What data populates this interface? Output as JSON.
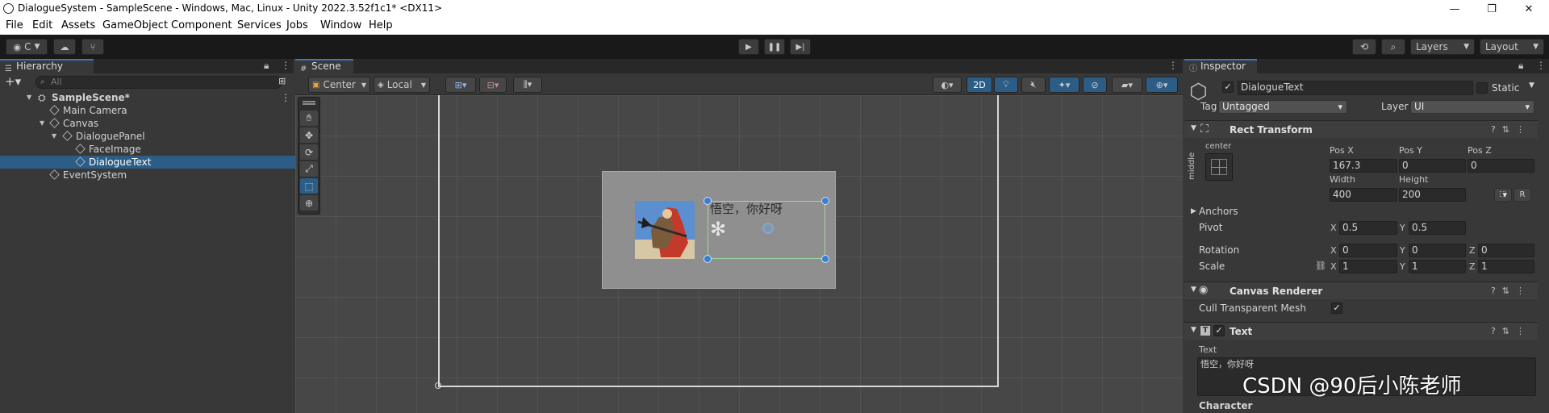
{
  "titlebar": {
    "title": "DialogueSystem - SampleScene - Windows, Mac, Linux - Unity 2022.3.52f1c1* <DX11>",
    "minimize": "—",
    "maximize": "❐",
    "close": "✕"
  },
  "menu": [
    "File",
    "Edit",
    "Assets",
    "GameObject",
    "Component",
    "Services",
    "Jobs",
    "Window",
    "Help"
  ],
  "toolbar": {
    "account_label": "C",
    "layers_label": "Layers",
    "layout_label": "Layout"
  },
  "hierarchy": {
    "tab": "Hierarchy",
    "search_placeholder": "All",
    "items": [
      {
        "label": "SampleScene*",
        "depth": 0
      },
      {
        "label": "Main Camera",
        "depth": 1
      },
      {
        "label": "Canvas",
        "depth": 1
      },
      {
        "label": "DialoguePanel",
        "depth": 2
      },
      {
        "label": "FaceImage",
        "depth": 3
      },
      {
        "label": "DialogueText",
        "depth": 3,
        "selected": true
      },
      {
        "label": "EventSystem",
        "depth": 1
      }
    ]
  },
  "scene": {
    "tab": "Scene",
    "pivot_mode": "Center",
    "pivot_space": "Local",
    "mode_2d": "2D",
    "dialogue_text": "悟空，你好呀"
  },
  "inspector": {
    "tab": "Inspector",
    "object_name": "DialogueText",
    "static_label": "Static",
    "tag_label": "Tag",
    "tag_value": "Untagged",
    "layer_label": "Layer",
    "layer_value": "UI",
    "rect_transform": {
      "title": "Rect Transform",
      "anchor_h": "center",
      "anchor_v": "middle",
      "pos_x_label": "Pos X",
      "pos_x": "167.3",
      "pos_y_label": "Pos Y",
      "pos_y": "0",
      "pos_z_label": "Pos Z",
      "pos_z": "0",
      "width_label": "Width",
      "width": "400",
      "height_label": "Height",
      "height": "200",
      "r_button": "R",
      "anchors_label": "Anchors",
      "pivot_label": "Pivot",
      "pivot_x": "0.5",
      "pivot_y": "0.5",
      "rotation_label": "Rotation",
      "rot_x": "0",
      "rot_y": "0",
      "rot_z": "0",
      "scale_label": "Scale",
      "scale_x": "1",
      "scale_y": "1",
      "scale_z": "1",
      "x": "X",
      "y": "Y",
      "z": "Z"
    },
    "canvas_renderer": {
      "title": "Canvas Renderer",
      "cull_label": "Cull Transparent Mesh"
    },
    "text": {
      "title": "Text",
      "text_label": "Text",
      "text_value": "悟空，你好呀",
      "character_label": "Character"
    }
  },
  "watermark": "CSDN @90后小陈老师"
}
